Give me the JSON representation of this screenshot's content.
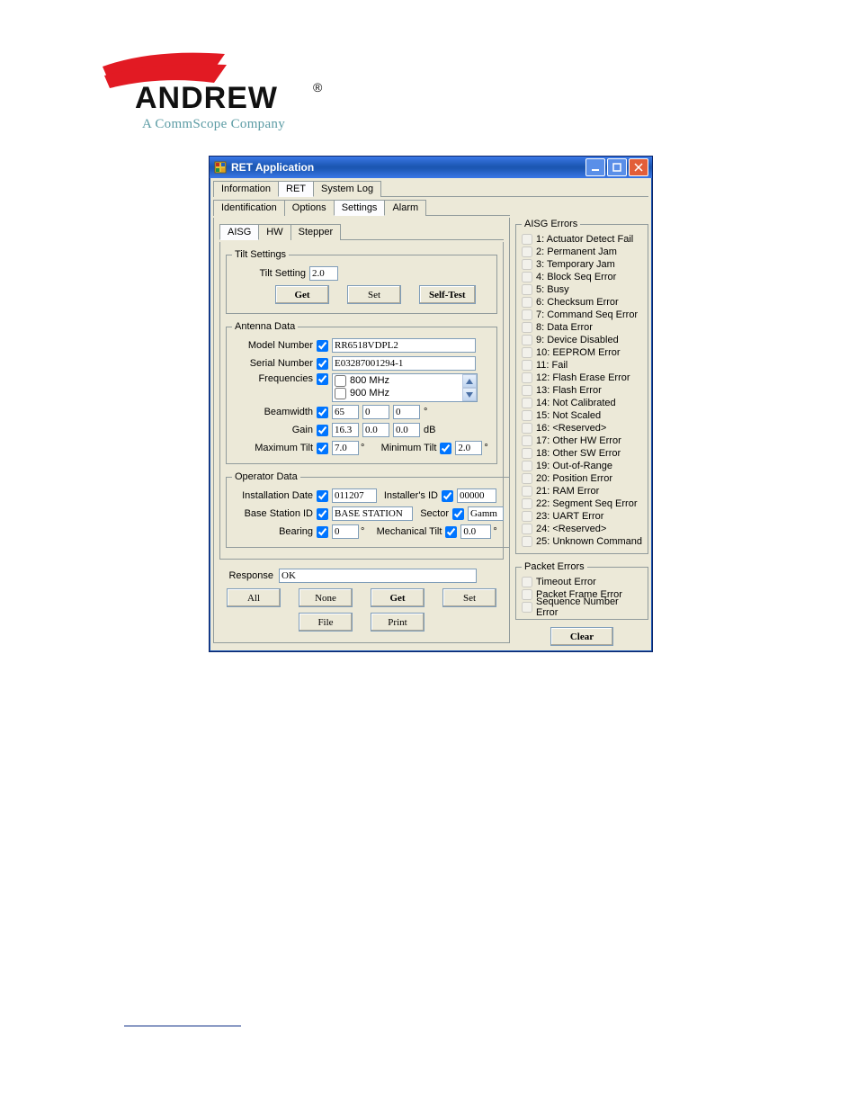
{
  "logo": {
    "main": "ANDREW",
    "reg": "®",
    "sub": "A CommScope Company"
  },
  "window": {
    "title": "RET Application"
  },
  "topTabs": [
    "Information",
    "RET",
    "System Log"
  ],
  "topTabActive": 1,
  "subTabs": [
    "Identification",
    "Options",
    "Settings",
    "Alarm"
  ],
  "subTabActive": 2,
  "innerTabs": [
    "AISG",
    "HW",
    "Stepper"
  ],
  "innerTabActive": 0,
  "tilt": {
    "legend": "Tilt Settings",
    "tiltSettingLabel": "Tilt Setting",
    "tiltSettingValue": "2.0",
    "get": "Get",
    "set": "Set",
    "selftest": "Self-Test"
  },
  "antenna": {
    "legend": "Antenna Data",
    "model": {
      "label": "Model Number",
      "value": "RR6518VDPL2"
    },
    "serial": {
      "label": "Serial Number",
      "value": "E03287001294-1"
    },
    "freq": {
      "label": "Frequencies",
      "opts": [
        "800 MHz",
        "900 MHz"
      ]
    },
    "beam": {
      "label": "Beamwidth",
      "v": [
        "65",
        "0",
        "0"
      ],
      "unit": "°"
    },
    "gain": {
      "label": "Gain",
      "v": [
        "16.3",
        "0.0",
        "0.0"
      ],
      "unit": "dB"
    },
    "maxtilt": {
      "label": "Maximum Tilt",
      "value": "7.0"
    },
    "mintilt": {
      "label": "Minimum Tilt",
      "value": "2.0"
    }
  },
  "operator": {
    "legend": "Operator Data",
    "instdate": {
      "label": "Installation Date",
      "value": "011207"
    },
    "instid": {
      "label": "Installer's ID",
      "value": "00000"
    },
    "bsid": {
      "label": "Base Station ID",
      "value": "BASE STATION"
    },
    "sector": {
      "label": "Sector",
      "value": "Gamm"
    },
    "bearing": {
      "label": "Bearing",
      "value": "0"
    },
    "mtilt": {
      "label": "Mechanical Tilt",
      "value": "0.0"
    }
  },
  "response": {
    "label": "Response",
    "value": "OK"
  },
  "midButtons": {
    "all": "All",
    "none": "None",
    "get": "Get",
    "set": "Set"
  },
  "lowButtons": {
    "file": "File",
    "print": "Print"
  },
  "aisgErrors": {
    "title": "AISG Errors",
    "items": [
      "1: Actuator Detect Fail",
      "2: Permanent Jam",
      "3: Temporary Jam",
      "4: Block Seq Error",
      "5: Busy",
      "6: Checksum Error",
      "7: Command Seq Error",
      "8: Data Error",
      "9: Device Disabled",
      "10: EEPROM Error",
      "11: Fail",
      "12: Flash Erase Error",
      "13: Flash Error",
      "14: Not Calibrated",
      "15: Not Scaled",
      "16: <Reserved>",
      "17: Other HW Error",
      "18: Other SW Error",
      "19: Out-of-Range",
      "20: Position Error",
      "21: RAM Error",
      "22: Segment Seq Error",
      "23: UART Error",
      "24: <Reserved>",
      "25: Unknown Command"
    ]
  },
  "packetErrors": {
    "title": "Packet Errors",
    "items": [
      "Timeout Error",
      "Packet Frame Error",
      "Sequence Number Error"
    ]
  },
  "clear": "Clear"
}
